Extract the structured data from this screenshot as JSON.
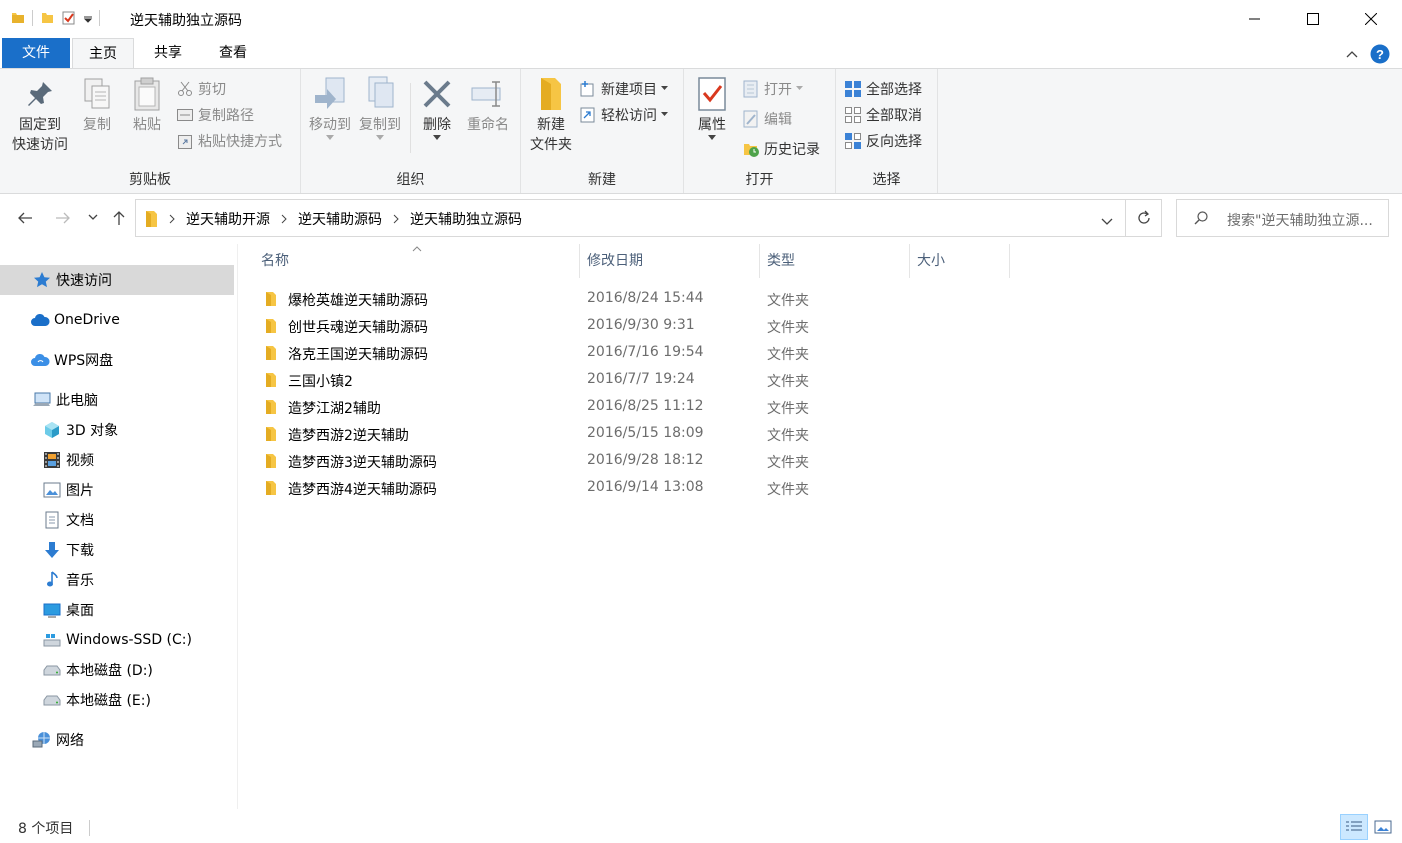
{
  "window": {
    "title": "逆天辅助独立源码",
    "controls": {
      "minimize": "minimize-icon",
      "maximize": "maximize-icon",
      "close": "close-icon"
    }
  },
  "tabs": {
    "file": "文件",
    "home": "主页",
    "share": "共享",
    "view": "查看"
  },
  "ribbon": {
    "clipboard": {
      "label": "剪贴板",
      "pin_line1": "固定到",
      "pin_line2": "快速访问",
      "copy": "复制",
      "paste": "粘贴",
      "cut": "剪切",
      "copy_path": "复制路径",
      "paste_shortcut": "粘贴快捷方式"
    },
    "organize": {
      "label": "组织",
      "move_to": "移动到",
      "copy_to": "复制到",
      "delete": "删除",
      "rename": "重命名"
    },
    "new": {
      "label": "新建",
      "new_folder_line1": "新建",
      "new_folder_line2": "文件夹",
      "new_item": "新建项目",
      "easy_access": "轻松访问"
    },
    "open": {
      "label": "打开",
      "properties": "属性",
      "open": "打开",
      "edit": "编辑",
      "history": "历史记录"
    },
    "select": {
      "label": "选择",
      "select_all": "全部选择",
      "select_none": "全部取消",
      "invert": "反向选择"
    }
  },
  "address": {
    "crumbs": [
      "逆天辅助开源",
      "逆天辅助源码",
      "逆天辅助独立源码"
    ],
    "search_placeholder": "搜索\"逆天辅助独立源..."
  },
  "nav": {
    "quick_access": "快速访问",
    "onedrive": "OneDrive",
    "wps": "WPS网盘",
    "this_pc": "此电脑",
    "objects3d": "3D 对象",
    "videos": "视频",
    "pictures": "图片",
    "documents": "文档",
    "downloads": "下载",
    "music": "音乐",
    "desktop": "桌面",
    "drive_c": "Windows-SSD (C:)",
    "drive_d": "本地磁盘 (D:)",
    "drive_e": "本地磁盘 (E:)",
    "network": "网络"
  },
  "columns": {
    "name": "名称",
    "date": "修改日期",
    "type": "类型",
    "size": "大小"
  },
  "files": [
    {
      "name": "爆枪英雄逆天辅助源码",
      "date": "2016/8/24 15:44",
      "type": "文件夹"
    },
    {
      "name": "创世兵魂逆天辅助源码",
      "date": "2016/9/30 9:31",
      "type": "文件夹"
    },
    {
      "name": "洛克王国逆天辅助源码",
      "date": "2016/7/16 19:54",
      "type": "文件夹"
    },
    {
      "name": "三国小镇2",
      "date": "2016/7/7 19:24",
      "type": "文件夹"
    },
    {
      "name": "造梦江湖2辅助",
      "date": "2016/8/25 11:12",
      "type": "文件夹"
    },
    {
      "name": "造梦西游2逆天辅助",
      "date": "2016/5/15 18:09",
      "type": "文件夹"
    },
    {
      "name": "造梦西游3逆天辅助源码",
      "date": "2016/9/28 18:12",
      "type": "文件夹"
    },
    {
      "name": "造梦西游4逆天辅助源码",
      "date": "2016/9/14 13:08",
      "type": "文件夹"
    }
  ],
  "status": {
    "count": "8 个项目"
  },
  "colors": {
    "accent": "#1a6fc9",
    "folder": "#f6c544",
    "selection": "#d9d9d9"
  }
}
